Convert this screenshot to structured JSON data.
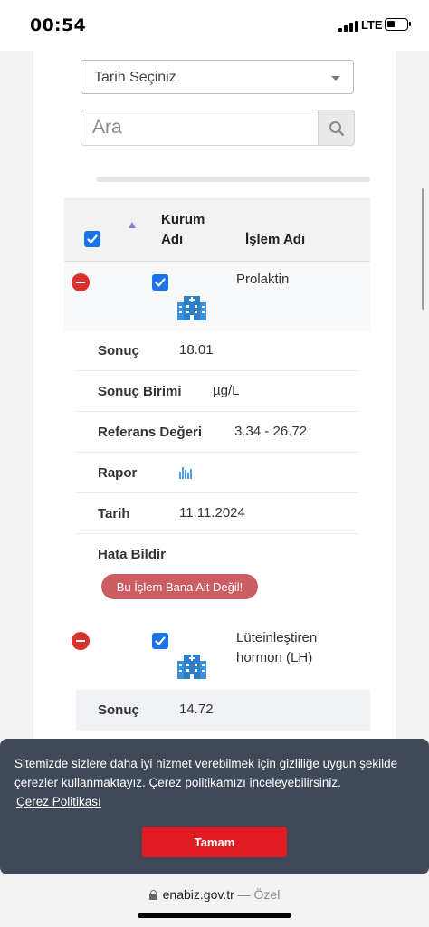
{
  "status_bar": {
    "time": "00:54",
    "network": "LTE",
    "icons": [
      "signal-icon",
      "battery-icon"
    ]
  },
  "filters": {
    "date_select_value": "Tarih Seçiniz",
    "search_placeholder": "Ara",
    "search_icon": "search-icon"
  },
  "table": {
    "columns": {
      "institution_line1": "Kurum",
      "institution_line2": "Adı",
      "procedure": "İşlem Adı"
    },
    "rows": [
      {
        "procedure_name": "Prolaktin",
        "details": [
          {
            "label": "Sonuç",
            "value": "18.01"
          },
          {
            "label": "Sonuç Birimi",
            "value": "µg/L"
          },
          {
            "label": "Referans Değeri",
            "value": "3.34 - 26.72"
          },
          {
            "label": "Rapor",
            "icon": "report-chart-icon"
          },
          {
            "label": "Tarih",
            "value": "11.11.2024"
          },
          {
            "label": "Hata Bildir"
          }
        ],
        "error_button": "Bu İşlem Bana Ait Değil!"
      },
      {
        "procedure_name_line1": "Lüteinleştiren",
        "procedure_name_line2": "hormon (LH)",
        "details": [
          {
            "label": "Sonuç",
            "value": "14.72"
          }
        ]
      }
    ]
  },
  "cookie_banner": {
    "text": "Sitemizde sizlere daha iyi hizmet verebilmek için gizliliğe uygun şekilde çerezler kullanmaktayız. Çerez politikamızı inceleyebilirsiniz.",
    "policy_link": "Çerez Politikası",
    "accept_button": "Tamam"
  },
  "browser": {
    "domain": "enabiz.gov.tr",
    "separator": "—",
    "mode": "Özel"
  },
  "colors": {
    "checkbox": "#1a73e8",
    "remove": "#d9312b",
    "error_button": "#cc5d62",
    "cookie_bg": "#404958",
    "accept": "#e11b22"
  }
}
